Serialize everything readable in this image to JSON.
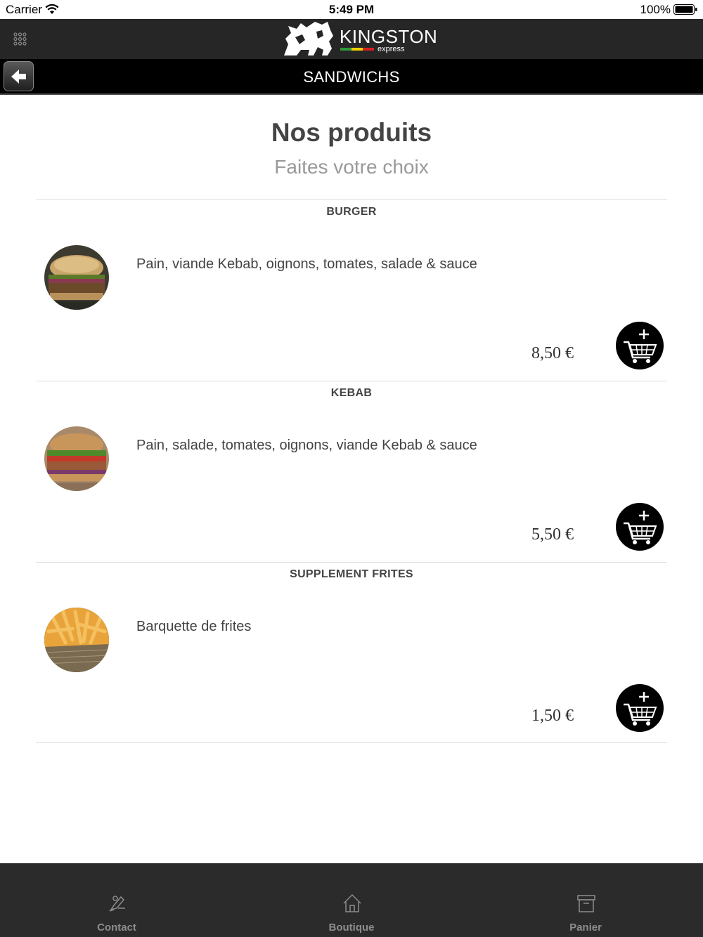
{
  "status_bar": {
    "carrier": "Carrier",
    "time": "5:49 PM",
    "battery": "100%"
  },
  "header": {
    "logo_name": "KINGSTON",
    "logo_sub": "express",
    "icons": [
      "menu-grid-icon",
      "lion-logo"
    ]
  },
  "title_bar": {
    "title": "SANDWICHS",
    "back_icon": "back-arrow-icon"
  },
  "main": {
    "title": "Nos produits",
    "subtitle": "Faites votre choix"
  },
  "products": [
    {
      "name": "BURGER",
      "description": "Pain, viande Kebab, oignons, tomates, salade & sauce",
      "price": "8,50 €",
      "image": "burger-photo"
    },
    {
      "name": "KEBAB",
      "description": "Pain, salade, tomates, oignons, viande Kebab & sauce",
      "price": "5,50 €",
      "image": "kebab-photo"
    },
    {
      "name": "SUPPLEMENT FRITES",
      "description": "Barquette de frites",
      "price": "1,50 €",
      "image": "fries-photo"
    }
  ],
  "tab_bar": {
    "tabs": [
      {
        "label": "Contact",
        "icon": "contact-icon"
      },
      {
        "label": "Boutique",
        "icon": "home-icon"
      },
      {
        "label": "Panier",
        "icon": "box-icon"
      }
    ]
  },
  "colors": {
    "header_bg": "#262626",
    "title_bar_bg": "#000000",
    "tab_bar_bg": "#2b2b2b",
    "logo_stripe": [
      "#2e9a3a",
      "#f0d000",
      "#d42020"
    ]
  }
}
